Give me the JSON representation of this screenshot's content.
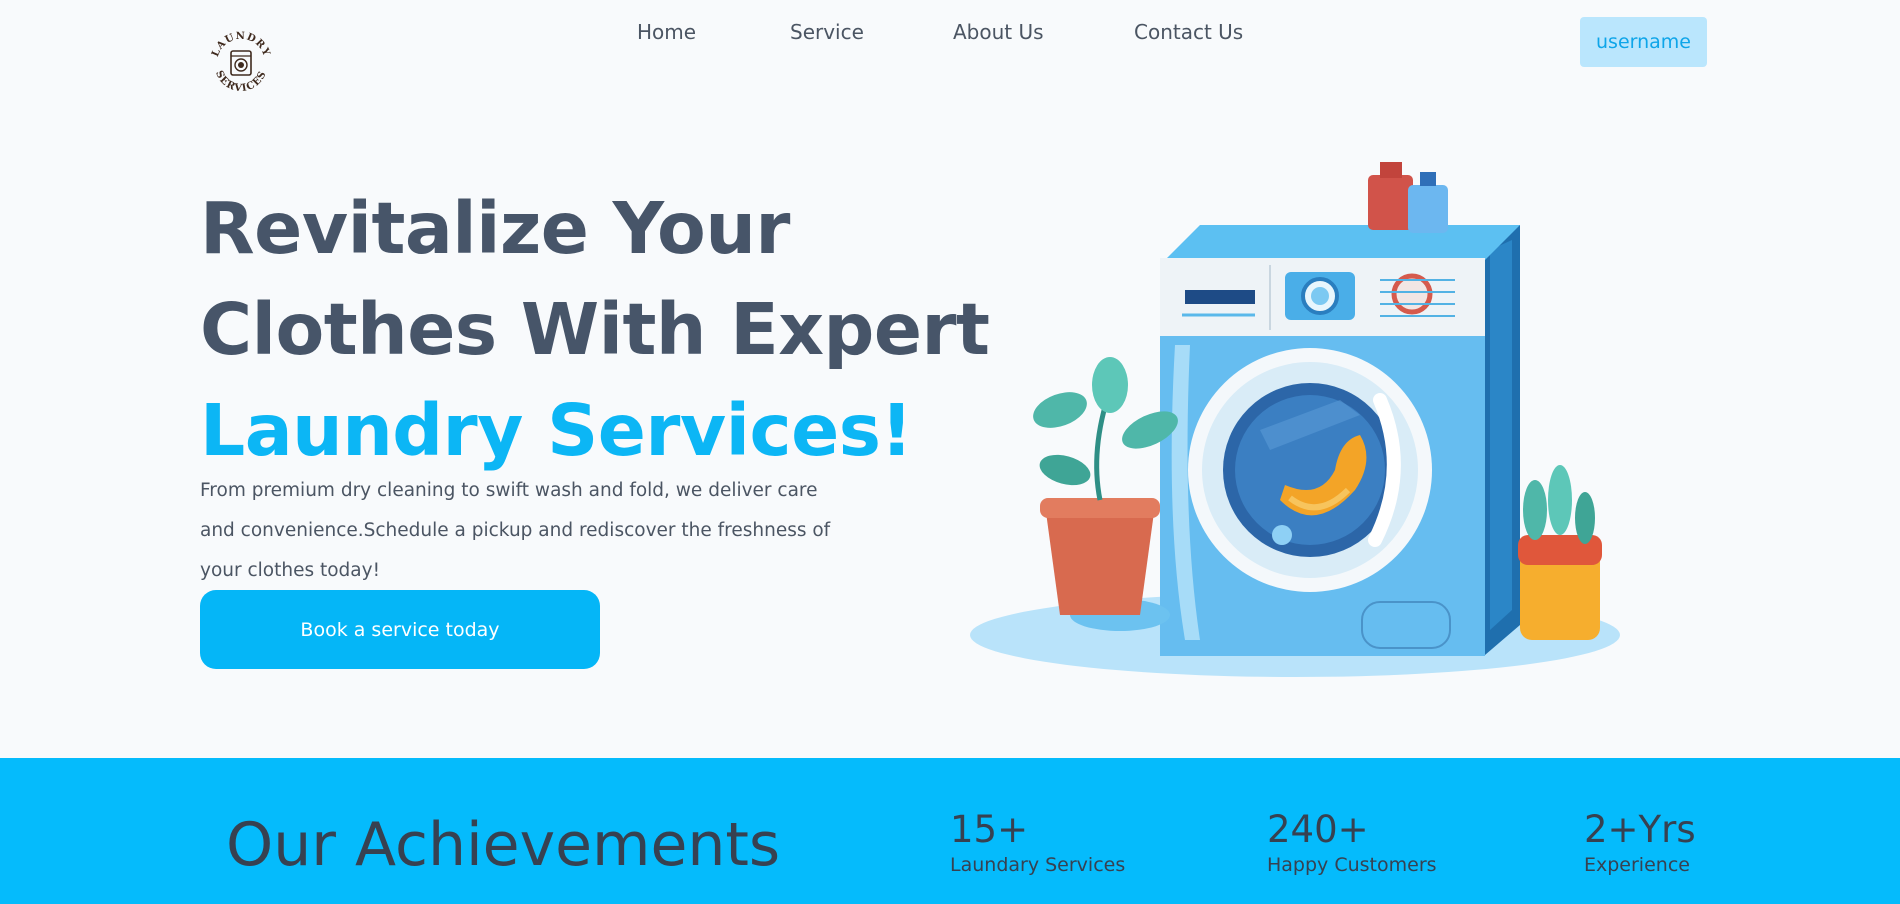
{
  "brand": {
    "logo_text_top": "LAUNDRY",
    "logo_text_bottom": "SERVICES"
  },
  "nav": {
    "items": [
      {
        "label": "Home"
      },
      {
        "label": "Service"
      },
      {
        "label": "About Us"
      },
      {
        "label": "Contact Us"
      }
    ],
    "user_label": "username"
  },
  "hero": {
    "title_line1": "Revitalize Your",
    "title_line2": "Clothes With Expert",
    "title_accent": "Laundry Services!",
    "description": "From premium dry cleaning to swift wash and fold, we deliver care and convenience.Schedule a pickup and rediscover the freshness of your clothes today!",
    "cta_label": "Book a service today"
  },
  "achievements": {
    "title": "Our Achievements",
    "stats": [
      {
        "value": "15+",
        "label": "Laundary Services"
      },
      {
        "value": "240+",
        "label": "Happy Customers"
      },
      {
        "value": "2+Yrs",
        "label": "Experience"
      }
    ]
  },
  "colors": {
    "accent": "#05b6f7",
    "band": "#05bbfc",
    "heading": "#475569",
    "user_button_bg": "#bae6fd"
  }
}
